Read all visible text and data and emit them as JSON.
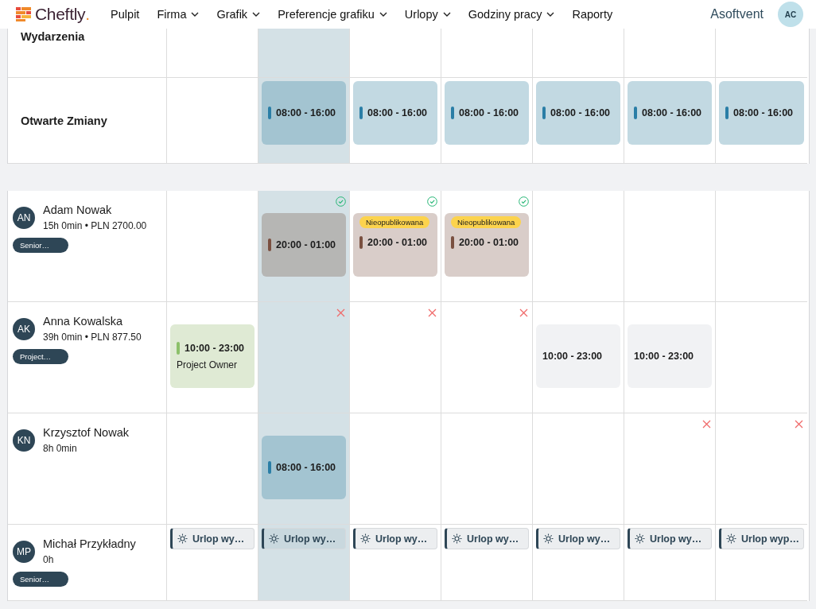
{
  "brand": {
    "name": "Cheftly",
    "mark": "."
  },
  "nav": [
    {
      "label": "Pulpit",
      "dropdown": false
    },
    {
      "label": "Firma",
      "dropdown": true
    },
    {
      "label": "Grafik",
      "dropdown": true
    },
    {
      "label": "Preferencje grafiku",
      "dropdown": true
    },
    {
      "label": "Urlopy",
      "dropdown": true
    },
    {
      "label": "Godziny pracy",
      "dropdown": true
    },
    {
      "label": "Raporty",
      "dropdown": false
    }
  ],
  "account": {
    "company": "Asoftvent",
    "initials": "AC"
  },
  "columns": [
    {
      "selected": false
    },
    {
      "selected": true
    },
    {
      "selected": false
    },
    {
      "selected": false
    },
    {
      "selected": false
    },
    {
      "selected": false
    },
    {
      "selected": false
    }
  ],
  "events_row": {
    "label": "Wydarzenia"
  },
  "open_shifts": {
    "label": "Otwarte Zmiany",
    "cells": [
      {},
      {
        "shift": {
          "kind": "open",
          "time": "08:00 - 16:00",
          "color": "#2a7ea6"
        }
      },
      {
        "shift": {
          "kind": "open",
          "time": "08:00 - 16:00",
          "color": "#2a7ea6"
        }
      },
      {
        "shift": {
          "kind": "open",
          "time": "08:00 - 16:00",
          "color": "#2a7ea6"
        }
      },
      {
        "shift": {
          "kind": "open",
          "time": "08:00 - 16:00",
          "color": "#2a7ea6"
        }
      },
      {
        "shift": {
          "kind": "open",
          "time": "08:00 - 16:00",
          "color": "#2a7ea6"
        }
      },
      {
        "shift": {
          "kind": "open",
          "time": "08:00 - 16:00",
          "color": "#2a7ea6"
        }
      }
    ]
  },
  "employees": [
    {
      "initials": "AN",
      "name": "Adam Nowak",
      "summary": "15h 0min • PLN 2700.00",
      "tag": "Senior…",
      "cells": [
        {},
        {
          "published": true,
          "shift": {
            "kind": "published",
            "time": "20:00 - 01:00",
            "color": "#7a5040"
          }
        },
        {
          "published": true,
          "shift": {
            "kind": "unpublished",
            "badge": "Nieopublikowana",
            "time": "20:00 - 01:00",
            "color": "#7a5040"
          }
        },
        {
          "published": true,
          "shift": {
            "kind": "unpublished",
            "badge": "Nieopublikowana",
            "time": "20:00 - 01:00",
            "color": "#7a5040"
          }
        },
        {},
        {},
        {}
      ]
    },
    {
      "initials": "AK",
      "name": "Anna Kowalska",
      "summary": "39h 0min • PLN 877.50",
      "tag": "Project…",
      "cells": [
        {
          "shift": {
            "kind": "role",
            "time": "10:00 - 23:00",
            "role": "Project Owner",
            "color": "#8cc06a"
          }
        },
        {
          "unavailable": true
        },
        {
          "unavailable": true
        },
        {
          "unavailable": true
        },
        {
          "shift": {
            "kind": "plain",
            "time": "10:00 - 23:00"
          }
        },
        {
          "shift": {
            "kind": "plain",
            "time": "10:00 - 23:00"
          }
        },
        {}
      ]
    },
    {
      "initials": "KN",
      "name": "Krzysztof Nowak",
      "summary": "8h 0min",
      "cells": [
        {},
        {
          "shift": {
            "kind": "open",
            "time": "08:00 - 16:00",
            "color": "#2a7ea6"
          }
        },
        {},
        {},
        {},
        {
          "unavailable": true
        },
        {
          "unavailable": true
        }
      ]
    },
    {
      "initials": "MP",
      "name": "Michał Przykładny",
      "summary": "0h",
      "tag": "Senior…",
      "cells": [
        {
          "leave": "Urlop wy…"
        },
        {
          "leave": "Urlop wy…"
        },
        {
          "leave": "Urlop wy…"
        },
        {
          "leave": "Urlop wy…"
        },
        {
          "leave": "Urlop wy…"
        },
        {
          "leave": "Urlop wy…"
        },
        {
          "leave": "Urlop wyp…"
        }
      ]
    }
  ]
}
